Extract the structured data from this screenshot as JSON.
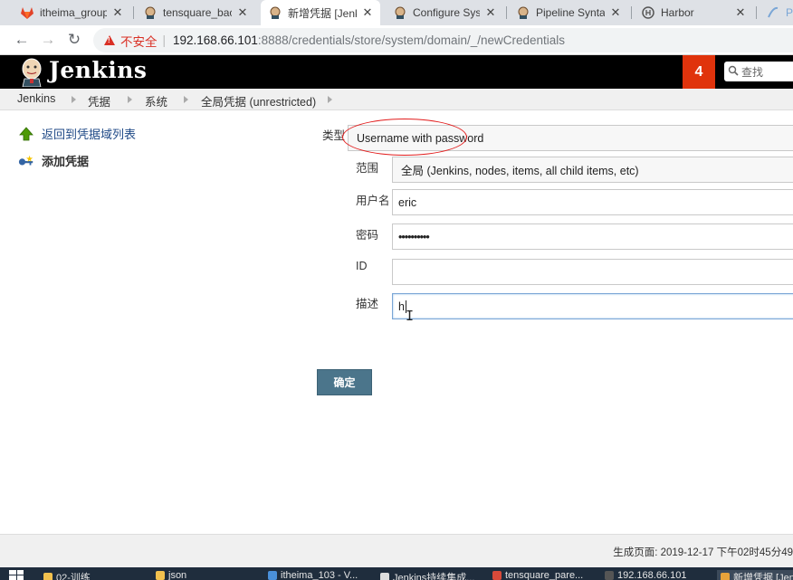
{
  "tabs": [
    {
      "label": "itheima_group",
      "icon": "gitlab-icon"
    },
    {
      "label": "tensquare_bac",
      "icon": "jenkins-icon"
    },
    {
      "label": "新增凭据 [Jenki",
      "icon": "jenkins-icon",
      "active": true
    },
    {
      "label": "Configure Syst",
      "icon": "jenkins-icon"
    },
    {
      "label": "Pipeline Synta",
      "icon": "jenkins-icon"
    },
    {
      "label": "Harbor",
      "icon": "harbor-icon"
    },
    {
      "label": "Pr",
      "icon": "page-icon"
    }
  ],
  "address": {
    "insecure_label": "不安全",
    "host": "192.168.66.101",
    "path": ":8888/credentials/store/system/domain/_/newCredentials"
  },
  "header": {
    "title": "Jenkins",
    "badge_count": "4",
    "search_placeholder": "查找",
    "brand_color": "#000000",
    "badge_color": "#e0330c"
  },
  "breadcrumbs": [
    "Jenkins",
    "凭据",
    "系统",
    "全局凭据 (unrestricted)"
  ],
  "sidebar": {
    "back_label": "返回到凭据域列表",
    "add_label": "添加凭据"
  },
  "form": {
    "kind_label": "类型",
    "kind_value": "Username with password",
    "scope_label": "范围",
    "scope_value": "全局 (Jenkins, nodes, items, all child items, etc)",
    "username_label": "用户名",
    "username_value": "eric",
    "password_label": "密码",
    "password_value": "••••••••••",
    "id_label": "ID",
    "id_value": "",
    "description_label": "描述",
    "description_value": "h",
    "submit_label": "确定"
  },
  "footer": {
    "generated": "生成页面: 2019-12-17 下午02时45分49"
  },
  "taskbar": {
    "items": [
      "02-训练",
      "json",
      "itheima_103 - V...",
      "Jenkins持续集成...",
      "tensquare_pare...",
      "192.168.66.101",
      "新增凭据 [Jen"
    ]
  }
}
